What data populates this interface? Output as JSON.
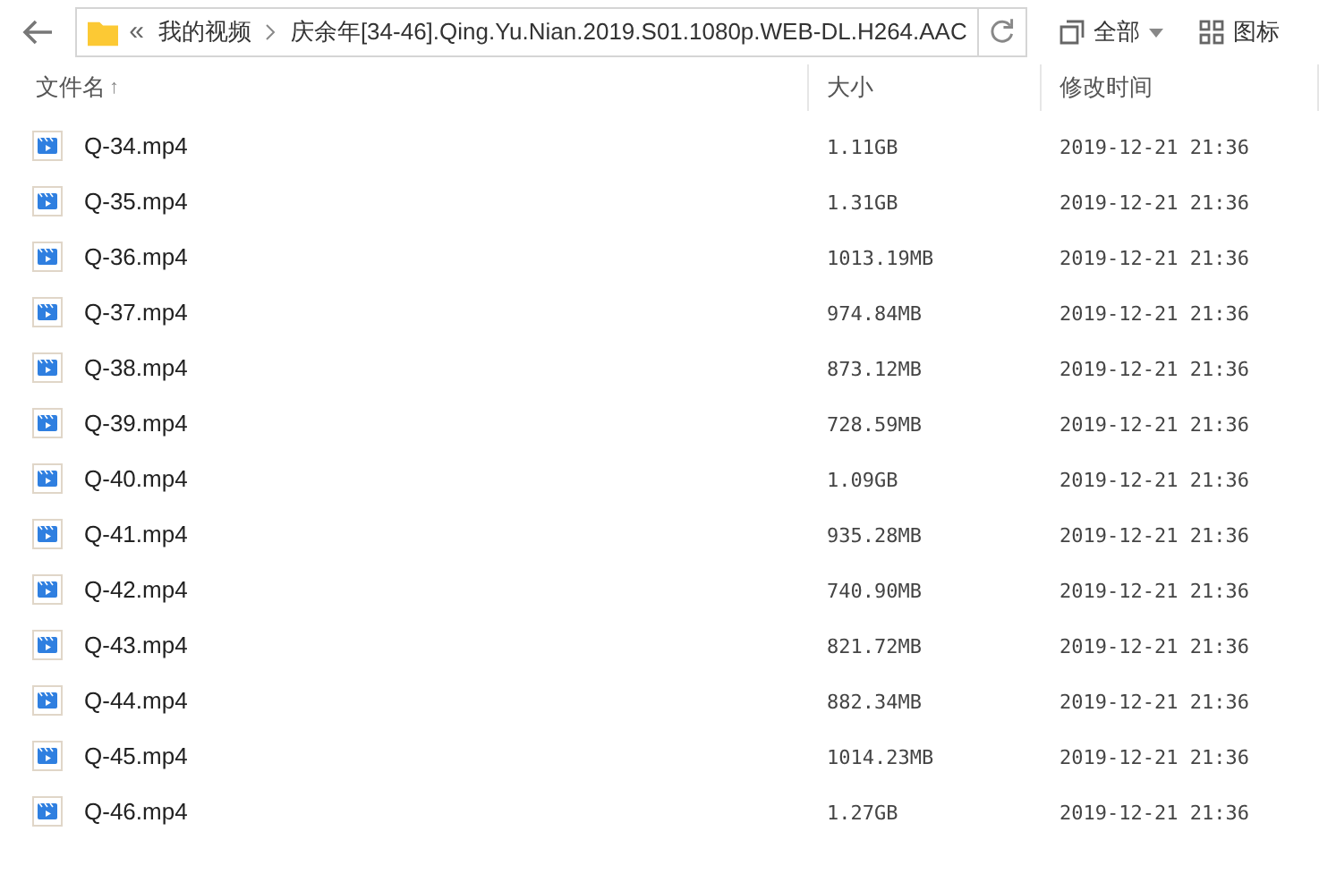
{
  "toolbar": {
    "breadcrumb_prefix": "«",
    "path": [
      {
        "label": "我的视频"
      },
      {
        "label": "庆余年[34-46].Qing.Yu.Nian.2019.S01.1080p.WEB-DL.H264.AAC"
      }
    ],
    "filter": "全部",
    "view": "图标"
  },
  "table": {
    "columns": [
      {
        "label": "文件名",
        "sort": "↑"
      },
      {
        "label": "大小"
      },
      {
        "label": "修改时间"
      }
    ],
    "rows": [
      {
        "name": "Q-34.mp4",
        "size": "1.11GB",
        "modified": "2019-12-21 21:36"
      },
      {
        "name": "Q-35.mp4",
        "size": "1.31GB",
        "modified": "2019-12-21 21:36"
      },
      {
        "name": "Q-36.mp4",
        "size": "1013.19MB",
        "modified": "2019-12-21 21:36"
      },
      {
        "name": "Q-37.mp4",
        "size": "974.84MB",
        "modified": "2019-12-21 21:36"
      },
      {
        "name": "Q-38.mp4",
        "size": "873.12MB",
        "modified": "2019-12-21 21:36"
      },
      {
        "name": "Q-39.mp4",
        "size": "728.59MB",
        "modified": "2019-12-21 21:36"
      },
      {
        "name": "Q-40.mp4",
        "size": "1.09GB",
        "modified": "2019-12-21 21:36"
      },
      {
        "name": "Q-41.mp4",
        "size": "935.28MB",
        "modified": "2019-12-21 21:36"
      },
      {
        "name": "Q-42.mp4",
        "size": "740.90MB",
        "modified": "2019-12-21 21:36"
      },
      {
        "name": "Q-43.mp4",
        "size": "821.72MB",
        "modified": "2019-12-21 21:36"
      },
      {
        "name": "Q-44.mp4",
        "size": "882.34MB",
        "modified": "2019-12-21 21:36"
      },
      {
        "name": "Q-45.mp4",
        "size": "1014.23MB",
        "modified": "2019-12-21 21:36"
      },
      {
        "name": "Q-46.mp4",
        "size": "1.27GB",
        "modified": "2019-12-21 21:36"
      }
    ]
  }
}
